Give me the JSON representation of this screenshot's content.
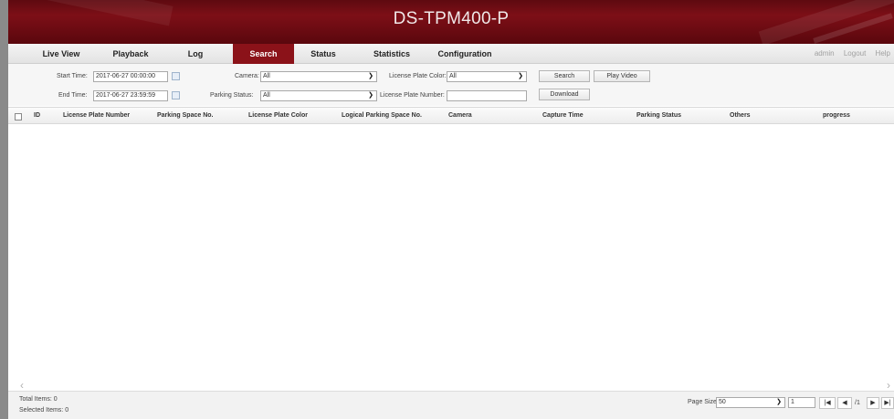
{
  "header": {
    "title": "DS-TPM400-P"
  },
  "menu": {
    "items": [
      {
        "label": "Live View"
      },
      {
        "label": "Playback"
      },
      {
        "label": "Log"
      },
      {
        "label": "Search"
      },
      {
        "label": "Status"
      },
      {
        "label": "Statistics"
      },
      {
        "label": "Configuration"
      }
    ],
    "active": "Search",
    "account": {
      "admin": "admin",
      "logout": "Logout",
      "help": "Help"
    }
  },
  "filters": {
    "start_time_label": "Start Time:",
    "start_time_value": "2017-06-27 00:00:00",
    "end_time_label": "End Time:",
    "end_time_value": "2017-06-27 23:59:59",
    "camera_label": "Camera:",
    "camera_value": "All",
    "parking_status_label": "Parking Status:",
    "parking_status_value": "All",
    "plate_color_label": "License Plate Color:",
    "plate_color_value": "All",
    "plate_number_label": "License Plate Number:",
    "plate_number_value": "",
    "search_button": "Search",
    "play_video_button": "Play Video",
    "download_button": "Download"
  },
  "table": {
    "columns": [
      "ID",
      "License Plate Number",
      "Parking Space No.",
      "License Plate Color",
      "Logical Parking Space No.",
      "Camera",
      "Capture Time",
      "Parking Status",
      "Others",
      "progress"
    ],
    "rows": []
  },
  "footer": {
    "total_items": "Total Items: 0",
    "selected_items": "Selected Items: 0",
    "page_size_label": "Page Size:",
    "page_size_value": "50",
    "page_input_value": "1",
    "page_indicator": "/1"
  },
  "icons": {
    "calendar": "calendar-icon",
    "dropdown": "chevron-down-icon",
    "first_page": "first-page-icon",
    "prev_page": "prev-page-icon",
    "next_page": "next-page-icon",
    "last_page": "last-page-icon"
  },
  "colors": {
    "brand": "#7d0f17",
    "active_tab": "#8b1219"
  }
}
